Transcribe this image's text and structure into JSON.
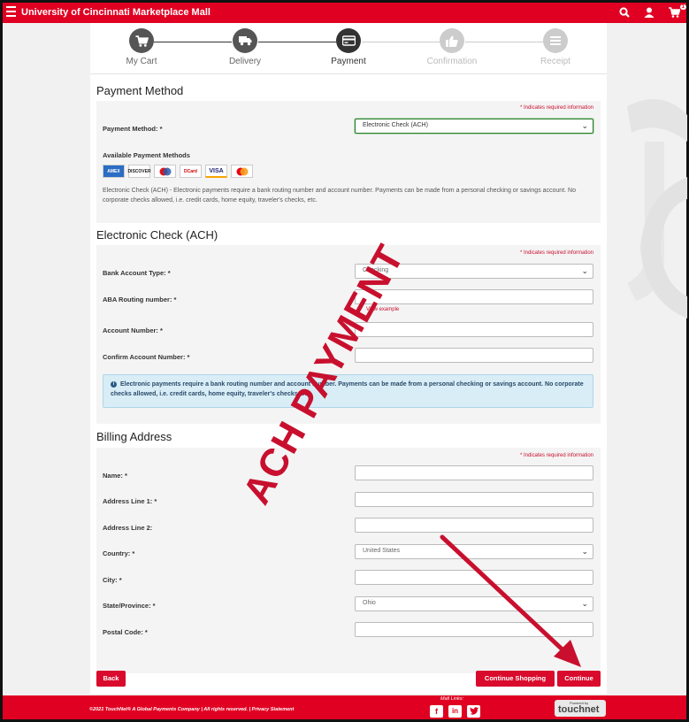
{
  "header": {
    "title": "University of Cincinnati Marketplace Mall",
    "cart_count": "1"
  },
  "steps": [
    {
      "label": "My Cart",
      "icon": "cart-icon",
      "state": "done"
    },
    {
      "label": "Delivery",
      "icon": "truck-icon",
      "state": "done"
    },
    {
      "label": "Payment",
      "icon": "credit-card-icon",
      "state": "active"
    },
    {
      "label": "Confirmation",
      "icon": "thumbs-up-icon",
      "state": "todo"
    },
    {
      "label": "Receipt",
      "icon": "receipt-icon",
      "state": "todo"
    }
  ],
  "payment_method": {
    "heading": "Payment Method",
    "required_note": "* Indicates required information",
    "label": "Payment Method: *",
    "selected": "Electronic Check (ACH)",
    "available_label": "Available Payment Methods",
    "cards": [
      "AMEX",
      "DISCOVER",
      "MC",
      "DCard",
      "VISA",
      "MC"
    ],
    "description": "Electronic Check (ACH) - Electronic payments require a bank routing number and account number. Payments can be made from a personal checking or savings account. No corporate checks allowed, i.e. credit cards, home equity, traveler's checks, etc."
  },
  "ach": {
    "heading": "Electronic Check (ACH)",
    "required_note": "* Indicates required information",
    "bank_type_label": "Bank Account Type: *",
    "bank_type_value": "Checking",
    "routing_label": "ABA Routing number: *",
    "view_example": "View example",
    "account_label": "Account Number: *",
    "confirm_label": "Confirm Account Number: *",
    "note": "Electronic payments require a bank routing number and account number. Payments can be made from a personal checking or savings account. No corporate checks allowed, i.e. credit cards, home equity, traveler's checks, etc."
  },
  "billing": {
    "heading": "Billing Address",
    "required_note": "* Indicates required information",
    "name_label": "Name: *",
    "addr1_label": "Address Line 1: *",
    "addr2_label": "Address Line 2:",
    "country_label": "Country: *",
    "country_value": "United States",
    "city_label": "City: *",
    "state_label": "State/Province: *",
    "state_value": "Ohio",
    "postal_label": "Postal Code: *"
  },
  "buttons": {
    "back": "Back",
    "continue_shopping": "Continue Shopping",
    "continue": "Continue"
  },
  "annotation": {
    "stamp_text": "ACH PAYMENT",
    "color": "#c8102e"
  },
  "footer": {
    "copyright": "©2021 TouchNet® A Global Payments Company   |   All rights reserved.   |   Privacy Statement",
    "mall_links": "Mall Links:",
    "powered_by": "Powered by",
    "brand": "touchnet"
  }
}
